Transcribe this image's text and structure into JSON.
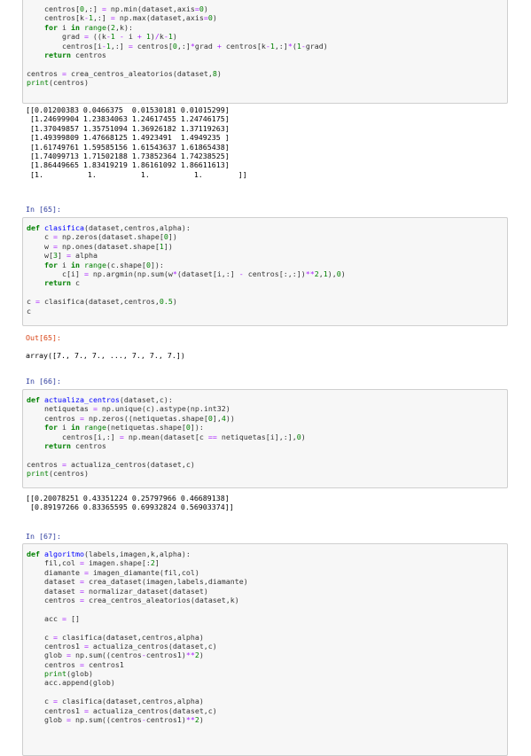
{
  "cells": {
    "c1_lines": [
      "    centros[0,:] = np.min(dataset,axis=0)",
      "    centros[k-1,:] = np.max(dataset,axis=0)",
      "    for i in range(2,k):",
      "        grad = ((k-1 - i + 1)/k-1)",
      "        centros[i-1,:] = centros[0,:]*grad + centros[k-1,:]*(1-grad)",
      "    return centros",
      "",
      "centros = crea_centros_aleatorios(dataset,8)",
      "print(centros)"
    ],
    "c1_output": [
      "[[0.01200383 0.0466375  0.01530181 0.01015299]",
      " [1.24699904 1.23834063 1.24617455 1.24746175]",
      " [1.37049857 1.35751094 1.36926182 1.37119263]",
      " [1.49399809 1.47668125 1.4923491  1.4949235 ]",
      " [1.61749761 1.59585156 1.61543637 1.61865438]",
      " [1.74099713 1.71502188 1.73852364 1.74238525]",
      " [1.86449665 1.83419219 1.86161092 1.86611613]",
      " [1.          1.          1.          1.        ]]"
    ],
    "c2_prompt": "In [65]:",
    "c2_lines": [
      "def clasifica(dataset,centros,alpha):",
      "    c = np.zeros(dataset.shape[0])",
      "    w = np.ones(dataset.shape[1])",
      "    w[3] = alpha",
      "    for i in range(c.shape[0]):",
      "        c[i] = np.argmin(np.sum(w*(dataset[i,:] - centros[:,:])**2,1),0)",
      "    return c",
      "",
      "c = clasifica(dataset,centros,0.5)",
      "c"
    ],
    "c2_out_prompt": "Out[65]:",
    "c2_output": [
      "array([7., 7., 7., ..., 7., 7., 7.])"
    ],
    "c3_prompt": "In [66]:",
    "c3_lines": [
      "def actualiza_centros(dataset,c):",
      "    netiquetas = np.unique(c).astype(np.int32)",
      "    centros = np.zeros((netiquetas.shape[0],4))",
      "    for i in range(netiquetas.shape[0]):",
      "        centros[i,:] = np.mean(dataset[c == netiquetas[i],:],0)",
      "    return centros",
      "",
      "centros = actualiza_centros(dataset,c)",
      "print(centros)"
    ],
    "c3_output": [
      "[[0.20078251 0.43351224 0.25797966 0.46689138]",
      " [0.89197266 0.83365595 0.69932824 0.56903374]]"
    ],
    "c4_prompt": "In [67]:",
    "c4_lines": [
      "def algoritmo(labels,imagen,k,alpha):",
      "    fil,col = imagen.shape[:2]",
      "    diamante = imagen_diamante(fil,col)",
      "    dataset = crea_dataset(imagen,labels,diamante)",
      "    dataset = normalizar_dataset(dataset)",
      "    centros = crea_centros_aleatorios(dataset,k)",
      "",
      "    acc = []",
      "",
      "    c = clasifica(dataset,centros,alpha)",
      "    centros1 = actualiza_centros(dataset,c)",
      "    glob = np.sum((centros-centros1)**2)",
      "    centros = centros1",
      "    print(glob)",
      "    acc.append(glob)",
      "",
      "    c = clasifica(dataset,centros,alpha)",
      "    centros1 = actualiza_centros(dataset,c)",
      "    glob = np.sum((centros-centros1)**2)"
    ]
  }
}
